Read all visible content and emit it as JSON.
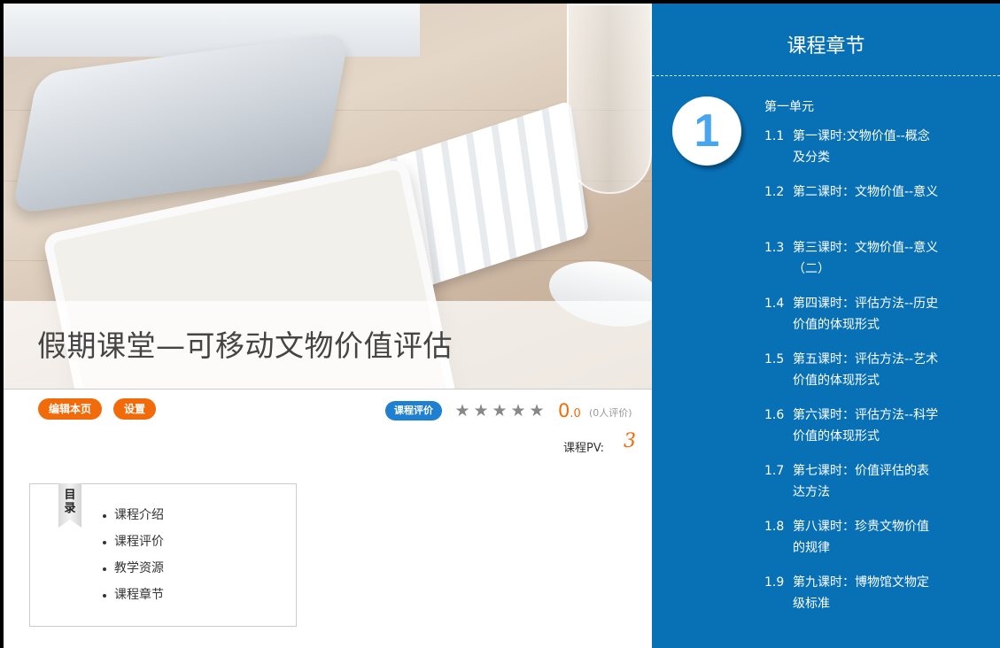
{
  "course": {
    "title": "假期课堂—可移动文物价值评估"
  },
  "actions": {
    "edit_label": "编辑本页",
    "settings_label": "设置"
  },
  "rating": {
    "badge_label": "课程评价",
    "stars": 5,
    "score_int": "0",
    "score_dec": ".0",
    "count_text": "(0人评价)",
    "pv_label": "课程PV:",
    "pv_value": "3"
  },
  "toc": {
    "label": "目录",
    "items": [
      "课程介绍",
      "课程评价",
      "教学资源",
      "课程章节"
    ]
  },
  "chapters": {
    "title": "课程章节",
    "unit_number": "1",
    "unit_name": "第一单元",
    "lessons": [
      {
        "num": "1.1",
        "text": "第一课时:文物价值--概念及分类"
      },
      {
        "num": "1.2",
        "text": "第二课时：文物价值--意义"
      },
      {
        "num": "1.3",
        "text": "第三课时：文物价值--意义（二）"
      },
      {
        "num": "1.4",
        "text": "第四课时：评估方法--历史价值的体现形式"
      },
      {
        "num": "1.5",
        "text": "第五课时：评估方法--艺术价值的体现形式"
      },
      {
        "num": "1.6",
        "text": "第六课时：评估方法--科学价值的体现形式"
      },
      {
        "num": "1.7",
        "text": "第七课时：价值评估的表达方法"
      },
      {
        "num": "1.8",
        "text": "第八课时：珍贵文物价值的规律"
      },
      {
        "num": "1.9",
        "text": "第九课时：博物馆文物定级标准"
      }
    ]
  },
  "colors": {
    "accent_orange": "#f26b0a",
    "panel_blue": "#0870b5",
    "badge_blue": "#1f7fd0"
  },
  "icons": {
    "star": "star-icon",
    "ribbon": "bookmark-ribbon-icon"
  }
}
